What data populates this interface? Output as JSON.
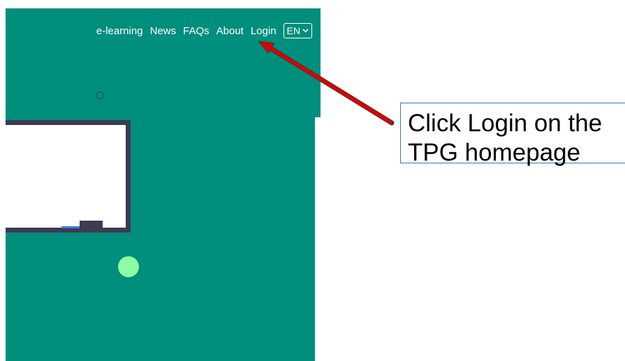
{
  "nav": {
    "items": [
      {
        "label": "e-learning"
      },
      {
        "label": "News"
      },
      {
        "label": "FAQs"
      },
      {
        "label": "About"
      },
      {
        "label": "Login"
      }
    ],
    "language": {
      "selected": "EN",
      "icon": "chevron-down-icon"
    }
  },
  "callout": {
    "line1": "Click Login on the",
    "line2": "TPG homepage"
  },
  "colors": {
    "teal": "#008e7d",
    "arrow": "#e00000",
    "callout_border": "#3e74b5"
  }
}
